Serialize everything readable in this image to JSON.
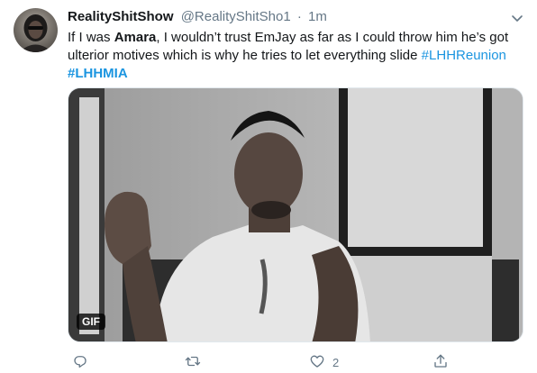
{
  "tweet": {
    "display_name": "RealityShitShow",
    "handle": "@RealityShitSho1",
    "separator": "·",
    "time": "1m",
    "text_parts": {
      "p1": "If I was ",
      "bold": "Amara",
      "p2": ", I wouldn’t trust EmJay as far as I could throw him he’s got ulterior motives which is why he tries to let everything slide ",
      "hashtag1": "#LHHReunion",
      "hashtag2": "#LHHMIA"
    },
    "media": {
      "badge": "GIF"
    },
    "actions": {
      "reply": {
        "icon": "reply-icon",
        "count": ""
      },
      "retweet": {
        "icon": "retweet-icon",
        "count": ""
      },
      "like": {
        "icon": "heart-icon",
        "count": "2"
      },
      "share": {
        "icon": "share-icon",
        "count": ""
      }
    },
    "colors": {
      "link": "#1b95e0",
      "muted": "#657786",
      "text": "#14171a"
    }
  }
}
